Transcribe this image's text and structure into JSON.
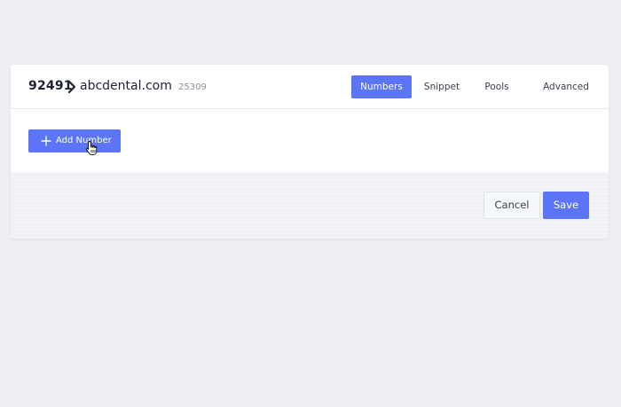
{
  "breadcrumb": {
    "id": "92491",
    "separator_icon": "chevron-right-icon",
    "domain": "abcdental.com",
    "code": "25309"
  },
  "tabs": [
    {
      "label": "Numbers",
      "active": true
    },
    {
      "label": "Snippet",
      "active": false
    },
    {
      "label": "Pools",
      "active": false
    },
    {
      "label": "Advanced",
      "active": false
    }
  ],
  "body": {
    "add_button_label": "Add Number",
    "add_button_icon": "plus-icon"
  },
  "footer": {
    "cancel_label": "Cancel",
    "save_label": "Save"
  },
  "colors": {
    "accent": "#5b75f6",
    "background": "#eceef3",
    "text": "#1e2233"
  }
}
